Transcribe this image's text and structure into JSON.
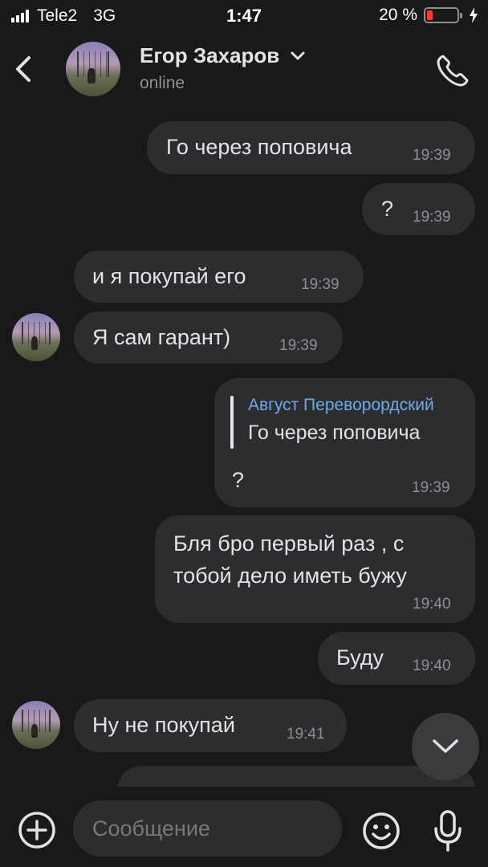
{
  "status_bar": {
    "carrier": "Tele2",
    "network": "3G",
    "time": "1:47",
    "battery": "20 %",
    "battery_level": 0.2
  },
  "header": {
    "contact_name": "Егор Захаров",
    "contact_status": "online",
    "icons": [
      "back-chevron-icon",
      "chevron-down-icon",
      "phone-icon"
    ]
  },
  "messages": [
    {
      "side": "outgoing",
      "text": "Го через поповича",
      "time": "19:39"
    },
    {
      "side": "outgoing",
      "text": "?",
      "time": "19:39"
    },
    {
      "side": "incoming",
      "text": "и я покупай его",
      "time": "19:39"
    },
    {
      "side": "incoming",
      "text": "Я сам гарант)",
      "time": "19:39"
    },
    {
      "side": "outgoing",
      "reply_author": "Август Переворордский",
      "reply_text": "Го через поповича",
      "text": "?",
      "time": "19:39"
    },
    {
      "side": "outgoing",
      "text_line1": "Бля бро первый раз , с",
      "text_line2": "тобой дело иметь бужу",
      "time": "19:40"
    },
    {
      "side": "outgoing",
      "text": "Буду",
      "time": "19:40"
    },
    {
      "side": "incoming",
      "text": "Ну не покупай",
      "time": "19:41"
    }
  ],
  "composer": {
    "placeholder": "Сообщение",
    "icons": [
      "plus-icon",
      "smile-icon",
      "microphone-icon"
    ]
  },
  "colors": {
    "background": "#19191a",
    "bubble": "#2c2d2e",
    "text": "#e1e3e6",
    "secondary": "#8d8f93",
    "accent": "#71aaeb",
    "battery_low": "#ff3b30"
  }
}
